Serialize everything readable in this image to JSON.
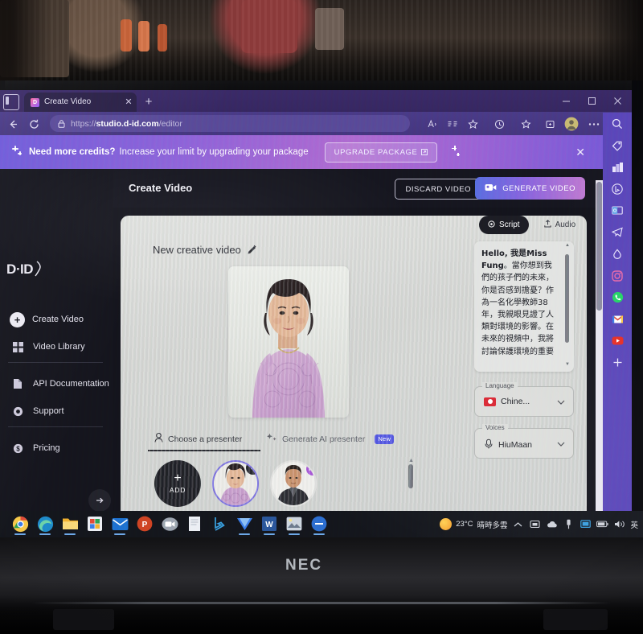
{
  "browser": {
    "tab": {
      "title": "Create Video",
      "favicon_label": "D"
    },
    "newtab_label": "+",
    "window_controls": {
      "minimize": "–",
      "maximize": "□",
      "close": "✕"
    },
    "omnibox": {
      "scheme": "https://",
      "host": "studio.d-id.com",
      "path": "/editor",
      "full_url": "https://studio.d-id.com/editor"
    },
    "toolbar_icons": [
      "read-aloud-icon",
      "immersive-reader-icon",
      "favorite-add-icon",
      "history-icon",
      "collections-icon",
      "split-screen-icon",
      "profile-icon",
      "settings-more-icon",
      "bing-copilot-icon"
    ],
    "sidebar_icons": [
      "search-icon",
      "shopping-tag-icon",
      "games-icon",
      "bing-icon",
      "outlook-icon",
      "telegram-icon",
      "drop-icon",
      "instagram-icon",
      "whatsapp-icon",
      "gmail-icon",
      "youtube-icon",
      "add-app-icon",
      "split-screen-icon",
      "settings-gear-icon"
    ]
  },
  "promo": {
    "headline": "Need more credits?",
    "subtext": "Increase your limit by upgrading your package",
    "button": "UPGRADE PACKAGE",
    "close_label": "✕"
  },
  "appbar": {
    "title": "Create Video",
    "discard_label": "DISCARD VIDEO",
    "generate_label": "GENERATE VIDEO"
  },
  "sidebar": {
    "logo": "D·ID",
    "items": [
      {
        "label": "Create Video",
        "icon": "plus-circle-icon"
      },
      {
        "label": "Video Library",
        "icon": "grid-icon"
      },
      {
        "label": "API Documentation",
        "icon": "document-icon"
      },
      {
        "label": "Support",
        "icon": "lifebuoy-icon"
      },
      {
        "label": "Pricing",
        "icon": "dollar-circle-icon"
      }
    ]
  },
  "canvas": {
    "video_title": "New creative video",
    "edit_icon": "pencil-icon",
    "presenter_tabs": [
      {
        "label": "Choose a presenter",
        "icon": "person-icon",
        "active": true
      },
      {
        "label": "Generate AI presenter",
        "icon": "sparkle-icon",
        "badge": "New",
        "active": false
      }
    ],
    "presenters": [
      {
        "type": "add",
        "label": "ADD",
        "icon": "plus-icon"
      },
      {
        "type": "selected",
        "remove_icon": "close-icon",
        "name": "presenter-female"
      },
      {
        "type": "option",
        "badge": "HQ",
        "name": "presenter-male"
      }
    ]
  },
  "script_panel": {
    "tabs": [
      {
        "label": "Script",
        "icon": "script-icon",
        "active": true
      },
      {
        "label": "Audio",
        "icon": "upload-icon",
        "active": false
      }
    ],
    "text_lead": "Hello, 我是Miss Fung",
    "text_body": "。當你想到我們的孩子們的未來，你是否感到擔憂？作為一名化學教師38年，我親眼見證了人類對環境的影響。在未來的視頻中，我將討論保護環境的重要",
    "tools": [
      "volume-icon",
      "pause-timer-icon",
      "mute-break-icon"
    ],
    "language": {
      "label": "Language",
      "value": "Chine...",
      "flag": "hong-kong-flag"
    },
    "voices": {
      "label": "Voices",
      "value": "HiuMaan",
      "icon": "voice-avatar-icon"
    }
  },
  "taskbar": {
    "apps": [
      "chrome-icon",
      "edge-icon",
      "file-explorer-icon",
      "store-icon",
      "mail-icon",
      "powerpoint-icon",
      "zoom-icon",
      "notepad-icon",
      "bing-icon",
      "wps-icon",
      "word-icon",
      "photos-icon",
      "minus-app-icon"
    ],
    "weather": {
      "temperature": "23°C",
      "condition": "晴時多雲"
    },
    "tray": [
      "chevron-up-icon",
      "onedrive-icon",
      "cloud-icon",
      "usb-icon",
      "display-icon",
      "battery-icon",
      "volume-icon"
    ],
    "ime": "英"
  },
  "device": {
    "brand": "NEC"
  },
  "colors": {
    "edge_purple": "#5b46b8",
    "promo_gradient_start": "#6f59d8",
    "promo_gradient_end": "#b06bd0",
    "generate_btn_start": "#5b6ee0",
    "generate_btn_end": "#c07ad0",
    "app_dark": "#15151d",
    "selected_ring": "#7b6fe0",
    "hq_badge": "#a855d8",
    "new_badge": "#4b4ee0"
  }
}
